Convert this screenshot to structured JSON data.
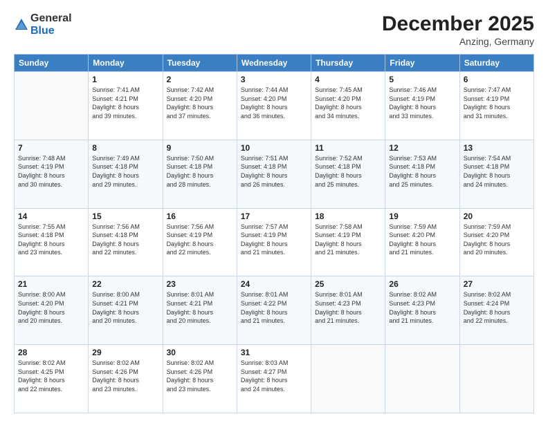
{
  "header": {
    "logo_general": "General",
    "logo_blue": "Blue",
    "month_year": "December 2025",
    "location": "Anzing, Germany"
  },
  "days_of_week": [
    "Sunday",
    "Monday",
    "Tuesday",
    "Wednesday",
    "Thursday",
    "Friday",
    "Saturday"
  ],
  "weeks": [
    [
      {
        "day": "",
        "info": ""
      },
      {
        "day": "1",
        "info": "Sunrise: 7:41 AM\nSunset: 4:21 PM\nDaylight: 8 hours\nand 39 minutes."
      },
      {
        "day": "2",
        "info": "Sunrise: 7:42 AM\nSunset: 4:20 PM\nDaylight: 8 hours\nand 37 minutes."
      },
      {
        "day": "3",
        "info": "Sunrise: 7:44 AM\nSunset: 4:20 PM\nDaylight: 8 hours\nand 36 minutes."
      },
      {
        "day": "4",
        "info": "Sunrise: 7:45 AM\nSunset: 4:20 PM\nDaylight: 8 hours\nand 34 minutes."
      },
      {
        "day": "5",
        "info": "Sunrise: 7:46 AM\nSunset: 4:19 PM\nDaylight: 8 hours\nand 33 minutes."
      },
      {
        "day": "6",
        "info": "Sunrise: 7:47 AM\nSunset: 4:19 PM\nDaylight: 8 hours\nand 31 minutes."
      }
    ],
    [
      {
        "day": "7",
        "info": "Sunrise: 7:48 AM\nSunset: 4:19 PM\nDaylight: 8 hours\nand 30 minutes."
      },
      {
        "day": "8",
        "info": "Sunrise: 7:49 AM\nSunset: 4:18 PM\nDaylight: 8 hours\nand 29 minutes."
      },
      {
        "day": "9",
        "info": "Sunrise: 7:50 AM\nSunset: 4:18 PM\nDaylight: 8 hours\nand 28 minutes."
      },
      {
        "day": "10",
        "info": "Sunrise: 7:51 AM\nSunset: 4:18 PM\nDaylight: 8 hours\nand 26 minutes."
      },
      {
        "day": "11",
        "info": "Sunrise: 7:52 AM\nSunset: 4:18 PM\nDaylight: 8 hours\nand 25 minutes."
      },
      {
        "day": "12",
        "info": "Sunrise: 7:53 AM\nSunset: 4:18 PM\nDaylight: 8 hours\nand 25 minutes."
      },
      {
        "day": "13",
        "info": "Sunrise: 7:54 AM\nSunset: 4:18 PM\nDaylight: 8 hours\nand 24 minutes."
      }
    ],
    [
      {
        "day": "14",
        "info": "Sunrise: 7:55 AM\nSunset: 4:18 PM\nDaylight: 8 hours\nand 23 minutes."
      },
      {
        "day": "15",
        "info": "Sunrise: 7:56 AM\nSunset: 4:18 PM\nDaylight: 8 hours\nand 22 minutes."
      },
      {
        "day": "16",
        "info": "Sunrise: 7:56 AM\nSunset: 4:19 PM\nDaylight: 8 hours\nand 22 minutes."
      },
      {
        "day": "17",
        "info": "Sunrise: 7:57 AM\nSunset: 4:19 PM\nDaylight: 8 hours\nand 21 minutes."
      },
      {
        "day": "18",
        "info": "Sunrise: 7:58 AM\nSunset: 4:19 PM\nDaylight: 8 hours\nand 21 minutes."
      },
      {
        "day": "19",
        "info": "Sunrise: 7:59 AM\nSunset: 4:20 PM\nDaylight: 8 hours\nand 21 minutes."
      },
      {
        "day": "20",
        "info": "Sunrise: 7:59 AM\nSunset: 4:20 PM\nDaylight: 8 hours\nand 20 minutes."
      }
    ],
    [
      {
        "day": "21",
        "info": "Sunrise: 8:00 AM\nSunset: 4:20 PM\nDaylight: 8 hours\nand 20 minutes."
      },
      {
        "day": "22",
        "info": "Sunrise: 8:00 AM\nSunset: 4:21 PM\nDaylight: 8 hours\nand 20 minutes."
      },
      {
        "day": "23",
        "info": "Sunrise: 8:01 AM\nSunset: 4:21 PM\nDaylight: 8 hours\nand 20 minutes."
      },
      {
        "day": "24",
        "info": "Sunrise: 8:01 AM\nSunset: 4:22 PM\nDaylight: 8 hours\nand 21 minutes."
      },
      {
        "day": "25",
        "info": "Sunrise: 8:01 AM\nSunset: 4:23 PM\nDaylight: 8 hours\nand 21 minutes."
      },
      {
        "day": "26",
        "info": "Sunrise: 8:02 AM\nSunset: 4:23 PM\nDaylight: 8 hours\nand 21 minutes."
      },
      {
        "day": "27",
        "info": "Sunrise: 8:02 AM\nSunset: 4:24 PM\nDaylight: 8 hours\nand 22 minutes."
      }
    ],
    [
      {
        "day": "28",
        "info": "Sunrise: 8:02 AM\nSunset: 4:25 PM\nDaylight: 8 hours\nand 22 minutes."
      },
      {
        "day": "29",
        "info": "Sunrise: 8:02 AM\nSunset: 4:26 PM\nDaylight: 8 hours\nand 23 minutes."
      },
      {
        "day": "30",
        "info": "Sunrise: 8:02 AM\nSunset: 4:26 PM\nDaylight: 8 hours\nand 23 minutes."
      },
      {
        "day": "31",
        "info": "Sunrise: 8:03 AM\nSunset: 4:27 PM\nDaylight: 8 hours\nand 24 minutes."
      },
      {
        "day": "",
        "info": ""
      },
      {
        "day": "",
        "info": ""
      },
      {
        "day": "",
        "info": ""
      }
    ]
  ]
}
